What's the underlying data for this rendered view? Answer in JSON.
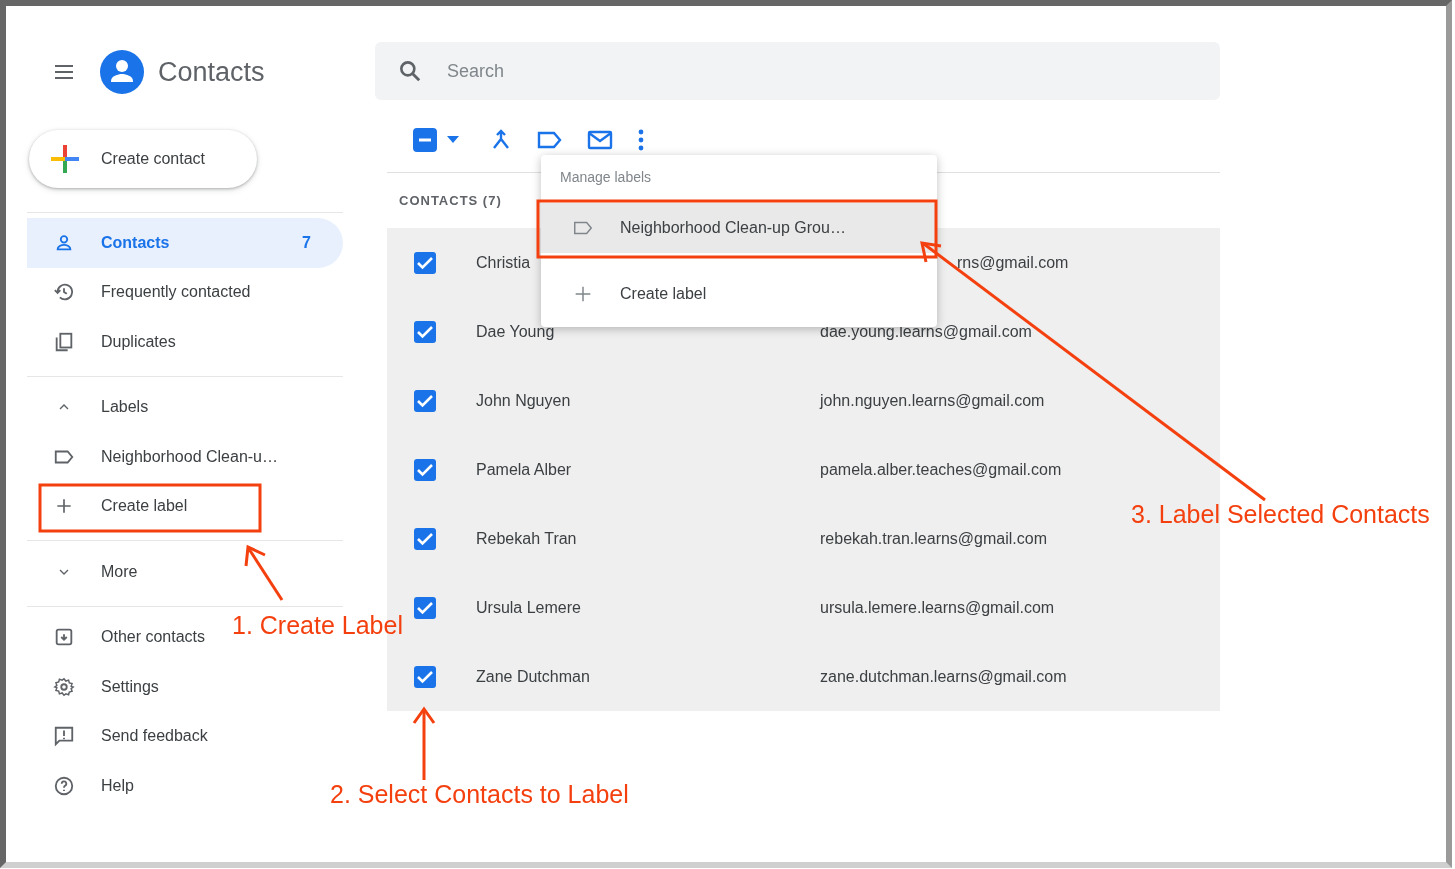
{
  "app": {
    "title": "Contacts"
  },
  "create_button": {
    "label": "Create contact"
  },
  "sidebar": {
    "sections": [
      [
        {
          "kind": "nav",
          "label": "Contacts",
          "count": "7",
          "selected": true
        },
        {
          "kind": "nav",
          "label": "Frequently contacted",
          "selected": false
        },
        {
          "kind": "nav",
          "label": "Duplicates",
          "selected": false
        }
      ],
      [
        {
          "kind": "toggle",
          "label": "Labels",
          "expanded": true
        },
        {
          "kind": "label",
          "label": "Neighborhood Clean-u…",
          "selected": false
        },
        {
          "kind": "add",
          "label": "Create label",
          "selected": false
        }
      ],
      [
        {
          "kind": "toggle",
          "label": "More",
          "expanded": false
        }
      ],
      [
        {
          "kind": "nav",
          "label": "Other contacts",
          "selected": false
        },
        {
          "kind": "nav",
          "label": "Settings",
          "selected": false
        },
        {
          "kind": "nav",
          "label": "Send feedback",
          "selected": false
        },
        {
          "kind": "nav",
          "label": "Help",
          "selected": false
        }
      ]
    ]
  },
  "search": {
    "placeholder": "Search"
  },
  "toolbar": {
    "select_all": {
      "checked": true,
      "indeterminate": true
    }
  },
  "menu": {
    "title": "Manage labels",
    "items": [
      {
        "kind": "label",
        "label": "Neighborhood Clean-up Grou…",
        "selected": true
      },
      {
        "kind": "add",
        "label": "Create label",
        "selected": false
      }
    ]
  },
  "table": {
    "heading": "CONTACTS (7)",
    "rows": [
      {
        "checked": true,
        "name": "Christia",
        "email": "rns@gmail.com"
      },
      {
        "checked": true,
        "name": "Dae Young",
        "email": "dae.young.learns@gmail.com"
      },
      {
        "checked": true,
        "name": "John Nguyen",
        "email": "john.nguyen.learns@gmail.com"
      },
      {
        "checked": true,
        "name": "Pamela Alber",
        "email": "pamela.alber.teaches@gmail.com"
      },
      {
        "checked": true,
        "name": "Rebekah Tran",
        "email": "rebekah.tran.learns@gmail.com"
      },
      {
        "checked": true,
        "name": "Ursula Lemere",
        "email": "ursula.lemere.learns@gmail.com"
      },
      {
        "checked": true,
        "name": "Zane Dutchman",
        "email": "zane.dutchman.learns@gmail.com"
      }
    ]
  },
  "annotations": [
    {
      "text": "1. Create Label"
    },
    {
      "text": "2. Select Contacts to Label"
    },
    {
      "text": "3. Label Selected Contacts"
    }
  ]
}
